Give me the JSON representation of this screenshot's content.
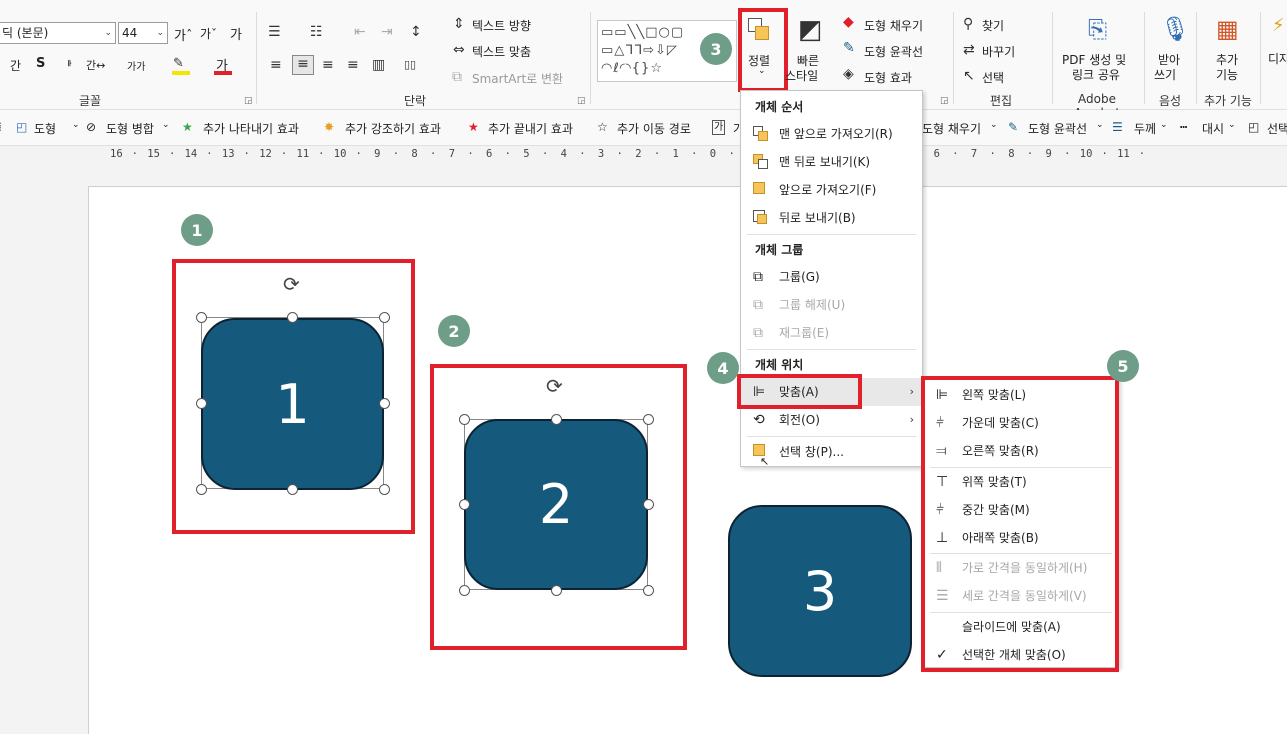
{
  "ribbon": {
    "font_name": "(본문)",
    "font_name_prefix": "딕",
    "font_size": "44",
    "grow_font": "가ˆ",
    "shrink_font": "가ˇ",
    "clear_format": "가",
    "shadow": "간",
    "bold_s": "S",
    "strike": "ᆘ",
    "char_spacing": "간↔",
    "change_case": "가가",
    "font_color_letter": "가",
    "groups": {
      "font": "글꼴",
      "paragraph": "단락",
      "edit": "편집",
      "adobe": "Adobe Acrobat",
      "voice": "음성",
      "addins": "추가 기능"
    },
    "text_direction": "텍스트 방향",
    "text_fit": "텍스트 맞춤",
    "smartart": "SmartArt로 변환",
    "arrange": "정렬",
    "quick_styles_1": "빠른",
    "quick_styles_2": "스타일",
    "shape_fill": "도형 채우기",
    "shape_outline": "도형 윤곽선",
    "shape_effects": "도형 효과",
    "find": "찾기",
    "replace": "바꾸기",
    "select": "선택",
    "pdf_1": "PDF 생성 및",
    "pdf_2": "링크 공유",
    "dictate_1": "받아",
    "dictate_2": "쓰기",
    "addins_1": "추가",
    "addins_2": "기능",
    "designer": "디자"
  },
  "subbar": {
    "shape": "도형",
    "merge": "도형 병합",
    "entrance": "추가 나타내기 효과",
    "emphasis": "추가 강조하기 효과",
    "exit": "추가 끝내기 효과",
    "motion": "추가 이동 경로",
    "text_frag": "가",
    "fill": "도형 채우기",
    "outline": "도형 윤곽선",
    "weight": "두께",
    "dash": "대시",
    "select_frag": "선택"
  },
  "ruler_labels": [
    "16",
    "15",
    "14",
    "13",
    "12",
    "11",
    "10",
    "9",
    "8",
    "7",
    "6",
    "5",
    "4",
    "3",
    "2",
    "1",
    "0",
    "1",
    "2",
    "3",
    "4",
    "5",
    "6",
    "7",
    "8",
    "9",
    "10",
    "11"
  ],
  "slide": {
    "shape1": "1",
    "shape2": "2",
    "shape3": "3"
  },
  "badges": [
    "1",
    "2",
    "3",
    "4",
    "5"
  ],
  "arrange_menu": {
    "order_head": "개체 순서",
    "bring_front": "맨 앞으로 가져오기(R)",
    "send_back": "맨 뒤로 보내기(K)",
    "bring_forward": "앞으로 가져오기(F)",
    "send_backward": "뒤로 보내기(B)",
    "group_head": "개체 그룹",
    "group": "그룹(G)",
    "ungroup": "그룹 해제(U)",
    "regroup": "재그룹(E)",
    "position_head": "개체 위치",
    "align": "맞춤(A)",
    "rotate": "회전(O)",
    "selection_pane": "선택 창(P)..."
  },
  "align_menu": {
    "left": "왼쪽 맞춤(L)",
    "center": "가운데 맞춤(C)",
    "right": "오른쪽 맞춤(R)",
    "top": "위쪽 맞춤(T)",
    "middle": "중간 맞춤(M)",
    "bottom": "아래쪽 맞춤(B)",
    "dist_h": "가로 간격을 동일하게(H)",
    "dist_v": "세로 간격을 동일하게(V)",
    "to_slide": "슬라이드에 맞춤(A)",
    "to_selected": "선택한 개체 맞춤(O)",
    "checkmark": "✓"
  },
  "colors": {
    "shape_fill": "#155a7c",
    "highlight_red": "#e0202a",
    "badge": "#6e9e88"
  }
}
